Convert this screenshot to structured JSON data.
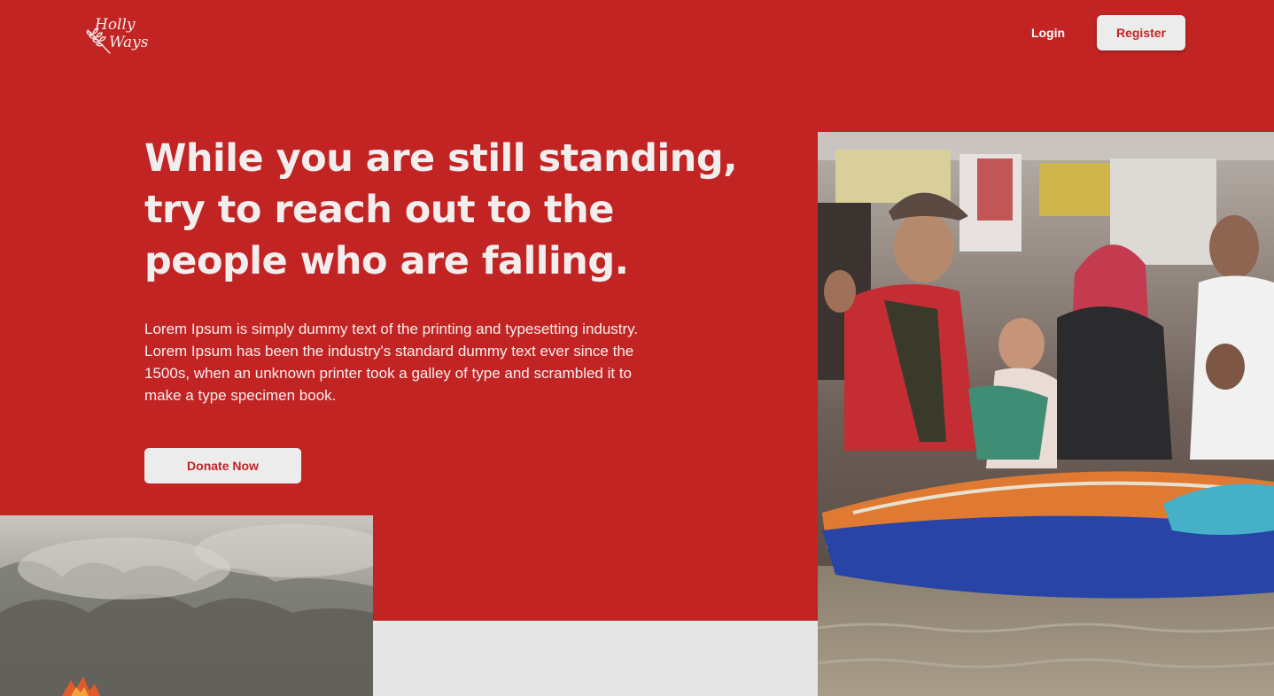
{
  "brand": {
    "logo_line1": "Holly",
    "logo_line2": "Ways"
  },
  "nav": {
    "login_label": "Login",
    "register_label": "Register"
  },
  "hero": {
    "headline": "While you are still standing, try to reach out to the people who are falling.",
    "body": "Lorem Ipsum is simply dummy text of the printing and typesetting industry. Lorem Ipsum has been the industry's standard dummy text ever since the 1500s, when an unknown printer took a galley of type and scrambled it to make a type specimen book.",
    "donate_label": "Donate Now"
  },
  "colors": {
    "brand_red": "#c22424",
    "button_bg": "#ececec",
    "section_gray": "#e6e6e6",
    "text_light": "#f3eeee"
  },
  "images": {
    "rescue_photo": "flood-rescue-boat-photo",
    "fire_photo": "forest-fire-smoke-photo"
  }
}
